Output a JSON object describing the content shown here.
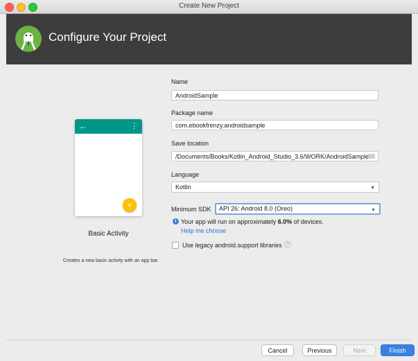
{
  "window": {
    "title": "Create New Project"
  },
  "header": {
    "title": "Configure Your Project",
    "logo_icon": "android-studio-icon"
  },
  "template": {
    "name": "Basic Activity",
    "description": "Creates a new basic activity with an app bar.",
    "preview_icons": [
      "back-arrow-icon",
      "overflow-menu-icon",
      "add-fab-icon"
    ]
  },
  "form": {
    "name_label": "Name",
    "name_value": "AndroidSample",
    "package_label": "Package name",
    "package_value": "com.ebookfrenzy.androidsample",
    "save_label": "Save location",
    "save_value": "/Documents/Books/Kotlin_Android_Studio_3.6/WORK/AndroidSample",
    "language_label": "Language",
    "language_value": "Kotlin",
    "min_sdk_label": "Minimum SDK",
    "min_sdk_value": "API 26: Android 8.0 (Oreo)",
    "info_prefix": "Your app will run on approximately ",
    "info_percent": "6.0%",
    "info_suffix": " of devices.",
    "help_link": "Help me choose",
    "legacy_label": "Use legacy android.support libraries",
    "legacy_checked": false
  },
  "buttons": {
    "cancel": "Cancel",
    "previous": "Previous",
    "next": "Next",
    "finish": "Finish"
  },
  "colors": {
    "header_bg": "#3d3d3d",
    "appbar": "#009688",
    "fab": "#ffc107",
    "primary": "#3b82e0",
    "link": "#2a6fdb"
  }
}
